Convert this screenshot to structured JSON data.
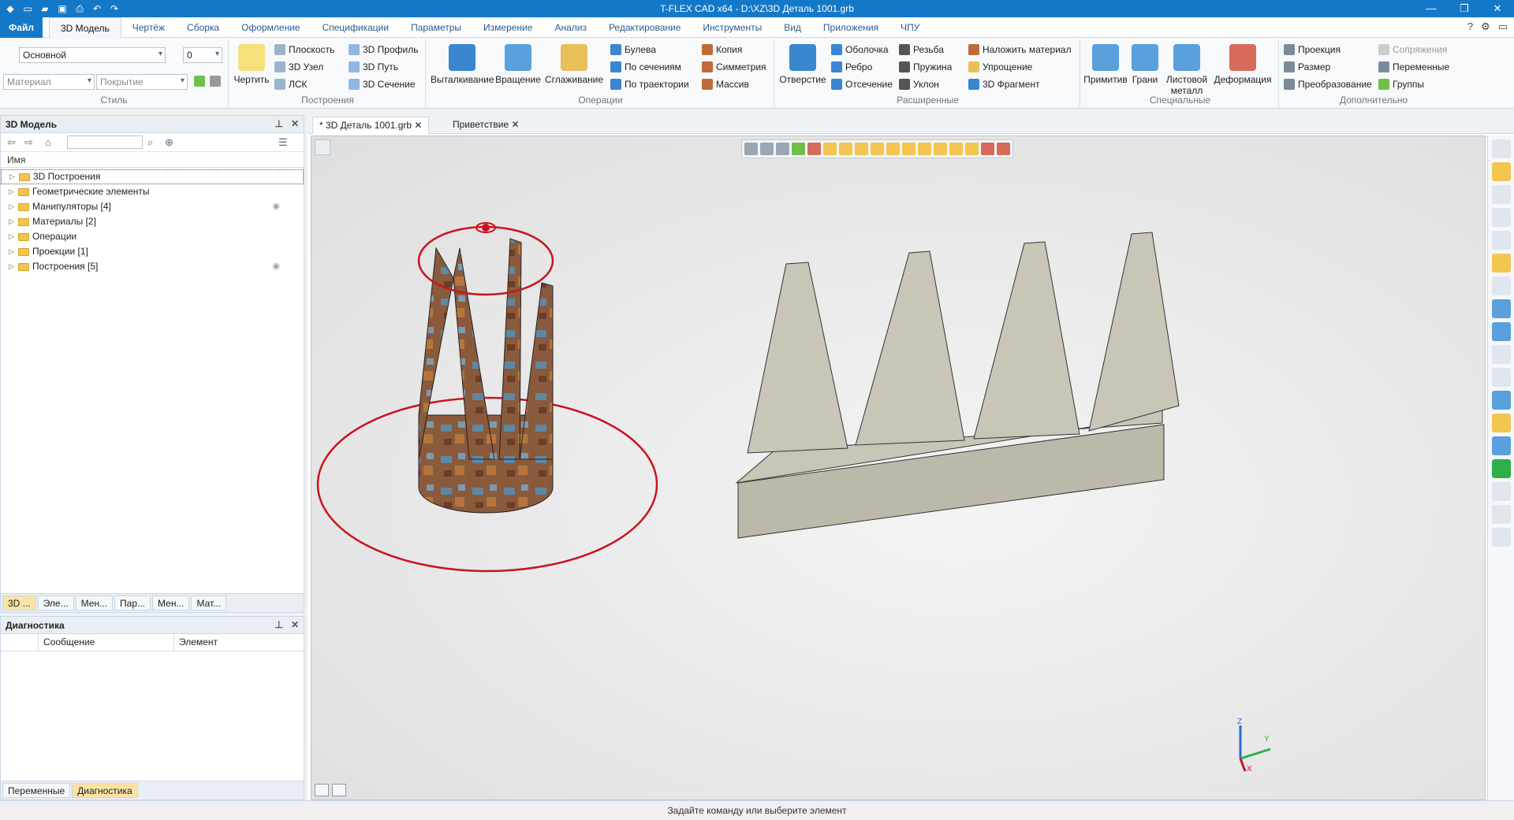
{
  "window": {
    "title": "T-FLEX CAD x64 - D:\\XZ\\3D Деталь 1001.grb",
    "min": "—",
    "max": "❐",
    "close": "✕"
  },
  "menu": {
    "file": "Файл",
    "tabs": [
      "3D Модель",
      "Чертёж",
      "Сборка",
      "Оформление",
      "Спецификации",
      "Параметры",
      "Измерение",
      "Анализ",
      "Редактирование",
      "Инструменты",
      "Вид",
      "Приложения",
      "ЧПУ"
    ]
  },
  "style": {
    "layer": "Основной",
    "num": "0",
    "material": "Материал",
    "coating": "Покрытие",
    "draw": "Чертить",
    "label": "Стиль"
  },
  "build": {
    "items": [
      "Плоскость",
      "3D Узел",
      "ЛСК",
      "3D Профиль",
      "3D Путь",
      "3D Сечение"
    ],
    "label": "Построения"
  },
  "ops": {
    "big": [
      "Выталкивание",
      "Вращение",
      "Сглаживание"
    ],
    "items": [
      "Булева",
      "По сечениям",
      "По траектории",
      "Копия",
      "Симметрия",
      "Массив"
    ],
    "label": "Операции"
  },
  "ext": {
    "big": "Отверстие",
    "items": [
      "Оболочка",
      "Ребро",
      "Отсечение",
      "Резьба",
      "Пружина",
      "Уклон",
      "Наложить материал",
      "Упрощение",
      "3D Фрагмент"
    ],
    "label": "Расширенные"
  },
  "spec": {
    "big": [
      "Примитив",
      "Грани",
      "Листовой металл",
      "Деформация"
    ],
    "label": "Специальные"
  },
  "extra": {
    "items": [
      "Проекция",
      "Размер",
      "Преобразование",
      "Сопряжения",
      "Переменные",
      "Группы"
    ],
    "label": "Дополнительно"
  },
  "model_pane": {
    "title": "3D Модель",
    "col": "Имя",
    "tree": [
      "3D Построения",
      "Геометрические элементы",
      "Манипуляторы [4]",
      "Материалы [2]",
      "Операции",
      "Проекции [1]",
      "Построения [5]"
    ],
    "tabs": [
      "3D ...",
      "Эле...",
      "Мен...",
      "Пар...",
      "Мен...",
      "Мат..."
    ]
  },
  "diag": {
    "title": "Диагностика",
    "cols": [
      "Сообщение",
      "Элемент"
    ],
    "tabs": [
      "Переменные",
      "Диагностика"
    ]
  },
  "docs": {
    "tabs": [
      "* 3D Деталь 1001.grb",
      "Приветствие"
    ]
  },
  "axes": {
    "z": "Z",
    "y": "Y",
    "x": "X"
  },
  "status": "Задайте команду или выберите элемент",
  "colors": {
    "accent": "#1478c8",
    "ring": "#c8141e",
    "plate": "#c9c6b8"
  }
}
